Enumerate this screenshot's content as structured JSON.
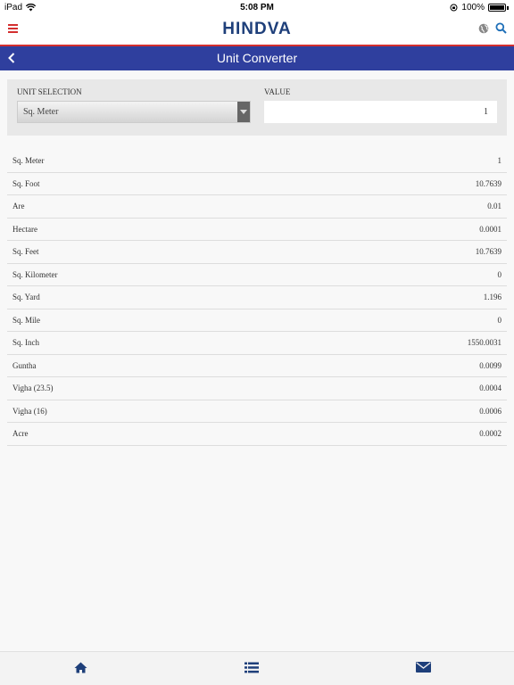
{
  "status_bar": {
    "device": "iPad",
    "time": "5:08 PM",
    "battery": "100%"
  },
  "header": {
    "brand": "HINDVA"
  },
  "titlebar": {
    "title": "Unit Converter"
  },
  "selection": {
    "unit_label": "UNIT SELECTION",
    "selected_unit": "Sq. Meter",
    "value_label": "VALUE",
    "value": "1"
  },
  "conversions": [
    {
      "unit": "Sq. Meter",
      "value": "1"
    },
    {
      "unit": "Sq. Foot",
      "value": "10.7639"
    },
    {
      "unit": "Are",
      "value": "0.01"
    },
    {
      "unit": "Hectare",
      "value": "0.0001"
    },
    {
      "unit": "Sq. Feet",
      "value": "10.7639"
    },
    {
      "unit": "Sq. Kilometer",
      "value": "0"
    },
    {
      "unit": "Sq. Yard",
      "value": "1.196"
    },
    {
      "unit": "Sq. Mile",
      "value": "0"
    },
    {
      "unit": "Sq. Inch",
      "value": "1550.0031"
    },
    {
      "unit": "Guntha",
      "value": "0.0099"
    },
    {
      "unit": "Vigha (23.5)",
      "value": "0.0004"
    },
    {
      "unit": "Vigha (16)",
      "value": "0.0006"
    },
    {
      "unit": "Acre",
      "value": "0.0002"
    }
  ],
  "colors": {
    "accent_red": "#d32f2f",
    "brand_blue": "#1e3f7a",
    "titlebar_blue": "#2f3f9e",
    "icon_blue": "#1e3f7a"
  },
  "icons": {
    "menu": "hamburger-icon",
    "globe": "globe-icon",
    "search": "search-icon",
    "back": "chevron-left-icon",
    "home": "home-icon",
    "list": "list-icon",
    "mail": "envelope-icon"
  }
}
